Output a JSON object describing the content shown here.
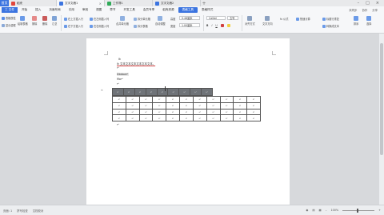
{
  "titlebar": {
    "home": "首页",
    "tabs": [
      {
        "label": "稻壳",
        "color": "#e0463c"
      },
      {
        "label": "文字文稿1",
        "color": "#3b74e0",
        "active": true
      },
      {
        "label": "工作簿1",
        "color": "#2eaa58"
      },
      {
        "label": "文字文稿2",
        "color": "#3b74e0"
      }
    ],
    "plus": "+"
  },
  "menubar": {
    "file": "三 文件",
    "items": [
      "开始",
      "插入",
      "页面布局",
      "引用",
      "审阅",
      "视图",
      "章节",
      "开发工具",
      "会员专享",
      "稻壳资源",
      "表格工具",
      "表格样式"
    ],
    "highlight": "表格工具",
    "sync": "未同步",
    "collab": "协作",
    "share": "分享"
  },
  "ribbon": {
    "props": "表格属性",
    "show_grid": "显示虚框",
    "draw_table": "绘制表格",
    "erase": "擦除",
    "delete": "删除",
    "summary": "汇总",
    "insert_above": "在上方插入行",
    "insert_below": "在下方插入行",
    "insert_left": "在左侧插入列",
    "insert_right": "在右侧插入列",
    "merge": "合并单元格",
    "split": "拆分单元格",
    "split_table": "拆分表格",
    "autofit": "自动调整",
    "height": "高度",
    "height_val": "0.48厘米",
    "width": "宽度",
    "width_val": "1.00厘米",
    "font_name": "Calibri",
    "font_size": "五号",
    "bold": "B",
    "italic": "I",
    "underline": "U",
    "align": "对齐方式",
    "text_dir": "文字方向",
    "formula": "fx 公式",
    "quick_calc": "快速计算",
    "title_repeat": "标题行重复",
    "to_text": "转换成文本",
    "sort": "排序",
    "select": "选择"
  },
  "doc": {
    "line1": "Ik",
    "line2": "Ik 文本文本文本文本文本文本。",
    "line3": "↵",
    "line4": "Dbdaw↵",
    "line5": "Mo↵",
    "line6": "↵",
    "page_marker": "↵",
    "head_table": {
      "rows": 1,
      "cols": 9,
      "cell": "↵"
    },
    "body_table": {
      "rows": 4,
      "cols": 11,
      "cell": "↵"
    }
  },
  "statusbar": {
    "page": "页面: 1",
    "spell": "拼写检查",
    "doc_check": "文档校对",
    "zoom": "100%"
  }
}
